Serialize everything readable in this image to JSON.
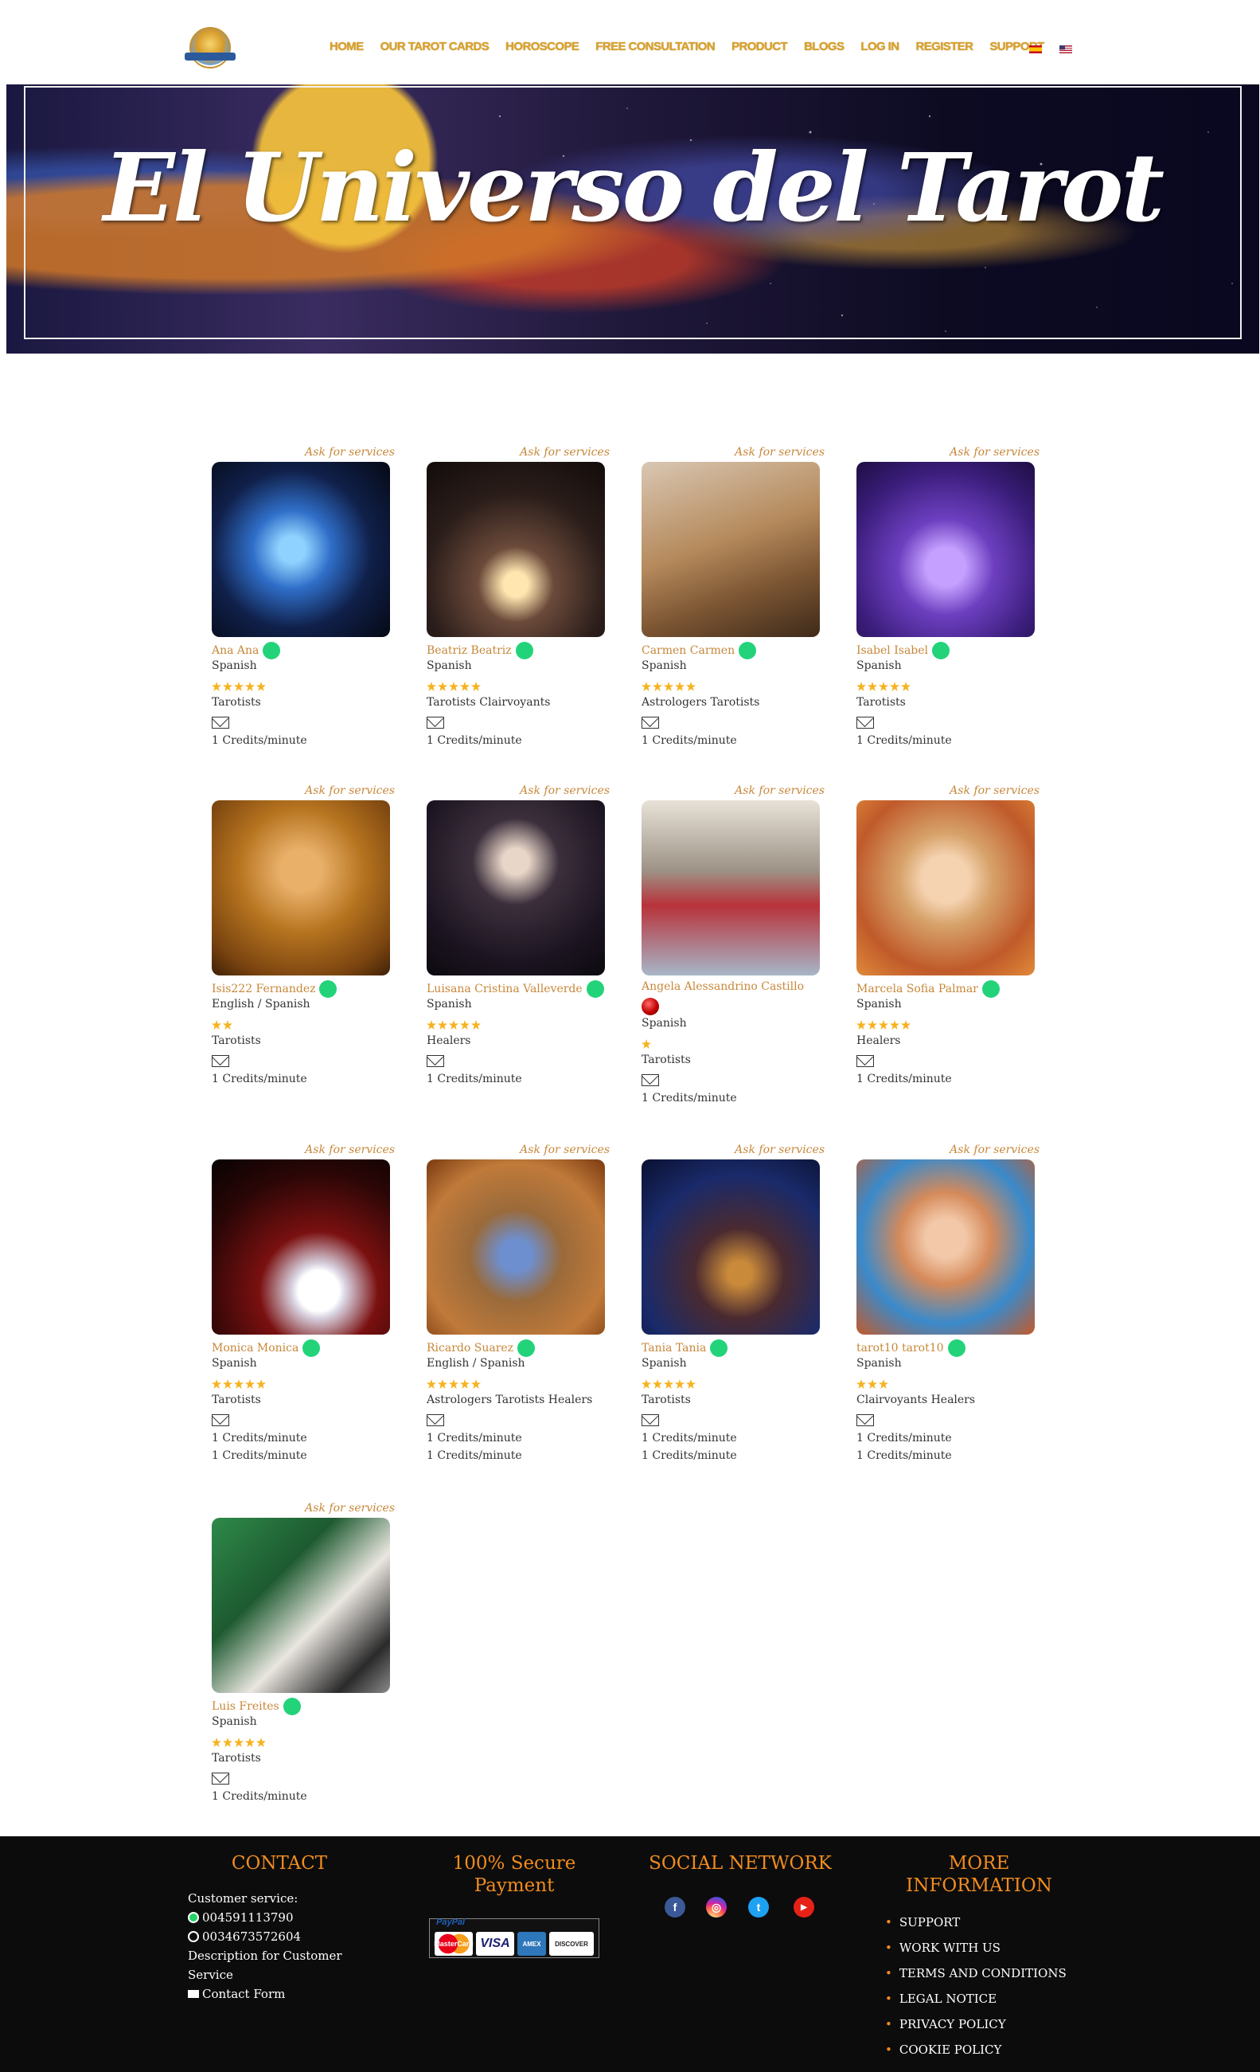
{
  "header": {
    "nav": [
      "HOME",
      "OUR TAROT CARDS",
      "HOROSCOPE",
      "FREE CONSULTATION",
      "PRODUCT",
      "BLOGS",
      "LOG IN",
      "REGISTER",
      "SUPPORT"
    ]
  },
  "banner": {
    "title": "El Universo del Tarot"
  },
  "ask_label": "Ask for services",
  "readers": [
    {
      "name": "Ana Ana",
      "language": "Spanish",
      "rating": 5,
      "specialty": "Tarotists",
      "rates": [
        "1 Credits/minute"
      ],
      "status": "online"
    },
    {
      "name": "Beatriz Beatriz",
      "language": "Spanish",
      "rating": 5,
      "specialty": "Tarotists Clairvoyants",
      "rates": [
        "1 Credits/minute"
      ],
      "status": "online"
    },
    {
      "name": "Carmen Carmen",
      "language": "Spanish",
      "rating": 5,
      "specialty": "Astrologers Tarotists",
      "rates": [
        "1 Credits/minute"
      ],
      "status": "online"
    },
    {
      "name": "Isabel Isabel",
      "language": "Spanish",
      "rating": 5,
      "specialty": "Tarotists",
      "rates": [
        "1 Credits/minute"
      ],
      "status": "online"
    },
    {
      "name": "Isis222 Fernandez",
      "language": "English / Spanish",
      "rating": 2,
      "specialty": "Tarotists",
      "rates": [
        "1 Credits/minute"
      ],
      "status": "online"
    },
    {
      "name": "Luisana Cristina Valleverde",
      "language": "Spanish",
      "rating": 5,
      "specialty": "Healers",
      "rates": [
        "1 Credits/minute"
      ],
      "status": "online"
    },
    {
      "name": "Angela Alessandrino Castillo",
      "language": "Spanish",
      "rating": 1,
      "specialty": "Tarotists",
      "rates": [
        "1 Credits/minute"
      ],
      "status": "busy"
    },
    {
      "name": "Marcela Sofia Palmar",
      "language": "Spanish",
      "rating": 5,
      "specialty": "Healers",
      "rates": [
        "1 Credits/minute"
      ],
      "status": "online"
    },
    {
      "name": "Monica Monica",
      "language": "Spanish",
      "rating": 5,
      "specialty": "Tarotists",
      "rates": [
        "1 Credits/minute",
        "1 Credits/minute"
      ],
      "status": "online"
    },
    {
      "name": "Ricardo Suarez",
      "language": "English / Spanish",
      "rating": 5,
      "specialty": "Astrologers Tarotists Healers",
      "rates": [
        "1 Credits/minute",
        "1 Credits/minute"
      ],
      "status": "online"
    },
    {
      "name": "Tania Tania",
      "language": "Spanish",
      "rating": 5,
      "specialty": "Tarotists",
      "rates": [
        "1 Credits/minute",
        "1 Credits/minute"
      ],
      "status": "online"
    },
    {
      "name": "tarot10 tarot10",
      "language": "Spanish",
      "rating": 3,
      "specialty": "Clairvoyants Healers",
      "rates": [
        "1 Credits/minute",
        "1 Credits/minute"
      ],
      "status": "online"
    },
    {
      "name": "Luis Freites",
      "language": "Spanish",
      "rating": 5,
      "specialty": "Tarotists",
      "rates": [
        "1 Credits/minute"
      ],
      "status": "online"
    }
  ],
  "footer": {
    "contact": {
      "title": "CONTACT",
      "customer_service": "Customer service:",
      "phone1": "004591113790",
      "phone2": "0034673572604",
      "description": "Description for Customer Service",
      "contact_form": "Contact Form"
    },
    "payment": {
      "title": "100% Secure Payment",
      "paypal": "PayPal",
      "cards": [
        "MasterCard",
        "VISA",
        "AMEX",
        "DISCOVER"
      ]
    },
    "social": {
      "title": "SOCIAL NETWORK",
      "networks": [
        "facebook-icon",
        "instagram-icon",
        "twitter-icon",
        "youtube-icon"
      ]
    },
    "more": {
      "title": "MORE INFORMATION",
      "links": [
        "SUPPORT",
        "WORK WITH US",
        "TERMS AND CONDITIONS",
        "LEGAL NOTICE",
        "PRIVACY POLICY",
        "COOKIE POLICY"
      ]
    }
  },
  "colors": {
    "accent": "#d8a22b",
    "name": "#c7873a",
    "online": "#22d37a",
    "footer_bg": "#0c0c0c",
    "footer_title": "#f08c1e"
  }
}
